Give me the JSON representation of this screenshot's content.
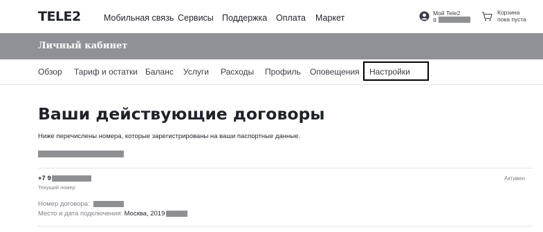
{
  "header": {
    "logo": "TELE2",
    "nav": [
      "Мобильная связь",
      "Сервисы",
      "Поддержка",
      "Оплата",
      "Маркет"
    ],
    "account": {
      "label": "Мой Tele2",
      "number_prefix": "9",
      "icon": "user-icon"
    },
    "cart": {
      "line1": "Корзина",
      "line2": "пока пуста",
      "icon": "cart-icon"
    }
  },
  "band": {
    "title": "Личный кабинет"
  },
  "tabs": [
    "Обзор",
    "Тариф и остатки",
    "Баланс",
    "Услуги",
    "Расходы",
    "Профиль",
    "Оповещения",
    "Настройки"
  ],
  "main": {
    "title": "Ваши действующие договоры",
    "subtitle": "Ниже перечислены номера, которые зарегистрированы на ваши паспортные данные.",
    "contract": {
      "phone_prefix": "+7 9",
      "phone_caption": "Текущий номер",
      "status": "Активен",
      "contract_label": "Номер договора:",
      "connection_label": "Место и дата подключения:",
      "connection_value": "Москва, 2019"
    }
  },
  "colors": {
    "band": "#8f9196",
    "mask": "#8f9094",
    "text": "#1f2229",
    "muted": "#7d8087"
  }
}
